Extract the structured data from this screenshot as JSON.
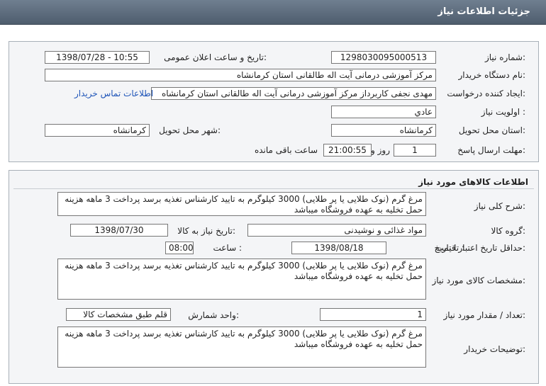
{
  "header": {
    "title": "جزئیات اطلاعات نیاز"
  },
  "info": {
    "need_number_label": "شماره نیاز:",
    "need_number": "1298030095000513",
    "announce_label": "تاریخ و ساعت اعلان عمومی:",
    "announce_value": "1398/07/28 - 10:55",
    "buyer_label": "نام دستگاه خریدار:",
    "buyer_value": "مرکز آموزشی درمانی آیت اله طالقانی استان کرمانشاه",
    "creator_label": "ایجاد کننده درخواست:",
    "creator_value": "مهدی نجفی کاربرداز مرکز آموزشی درمانی آیت اله طالقانی استان کرمانشاه",
    "contact_link": "اطلاعات تماس خریدار",
    "priority_label": "اولویت نیاز :",
    "priority_value": "عادي",
    "province_label": "استان محل تحویل:",
    "province_value": "کرمانشاه",
    "city_label": "شهر محل تحویل:",
    "city_value": "کرمانشاه",
    "deadline_label": "مهلت ارسال پاسخ:",
    "deadline_days": "1",
    "days_word": "روز و",
    "deadline_time": "21:00:55",
    "remaining_word": "ساعت باقی مانده"
  },
  "goods": {
    "section_title": "اطلاعات کالاهای مورد نیاز",
    "desc_label": "شرح کلی نیاز:",
    "desc_value": "مرغ گرم (نوک طلایی یا پر طلایی) 3000 کیلوگرم به تایید کارشناس تغذیه برسد پرداخت 3 ماهه هزینه حمل تخلیه به عهده فروشگاه میباشد",
    "group_label": "گروه کالا:",
    "group_value": "مواد غذائی و نوشیدنی",
    "need_date_label": "تاریخ نیاز به کالا:",
    "need_date_value": "1398/07/30",
    "price_valid_label": "حداقل تاریخ اعتبار قیمت:",
    "to_date_label": "تا تاریخ :",
    "to_date_value": "1398/08/18",
    "hour_label": "ساعت :",
    "hour_value": "08:00",
    "spec_label": "مشخصات کالای مورد نیاز:",
    "spec_value": "مرغ گرم (نوک طلایی یا پر طلایی) 3000 کیلوگرم به تایید کارشناس تغذیه برسد پرداخت 3 ماهه هزینه حمل تخلیه به عهده فروشگاه میباشد",
    "qty_label": "تعداد / مقدار مورد نیاز:",
    "qty_value": "1",
    "unit_label": "واحد شمارش:",
    "unit_value": "قلم طبق مشخصات کالا",
    "buyer_notes_label": "توضیحات خریدار:",
    "buyer_notes_value": "مرغ گرم (نوک طلایی یا پر طلایی) 3000 کیلوگرم به تایید کارشناس تغذیه برسد پرداخت 3 ماهه هزینه حمل تخلیه به عهده فروشگاه میباشد"
  }
}
